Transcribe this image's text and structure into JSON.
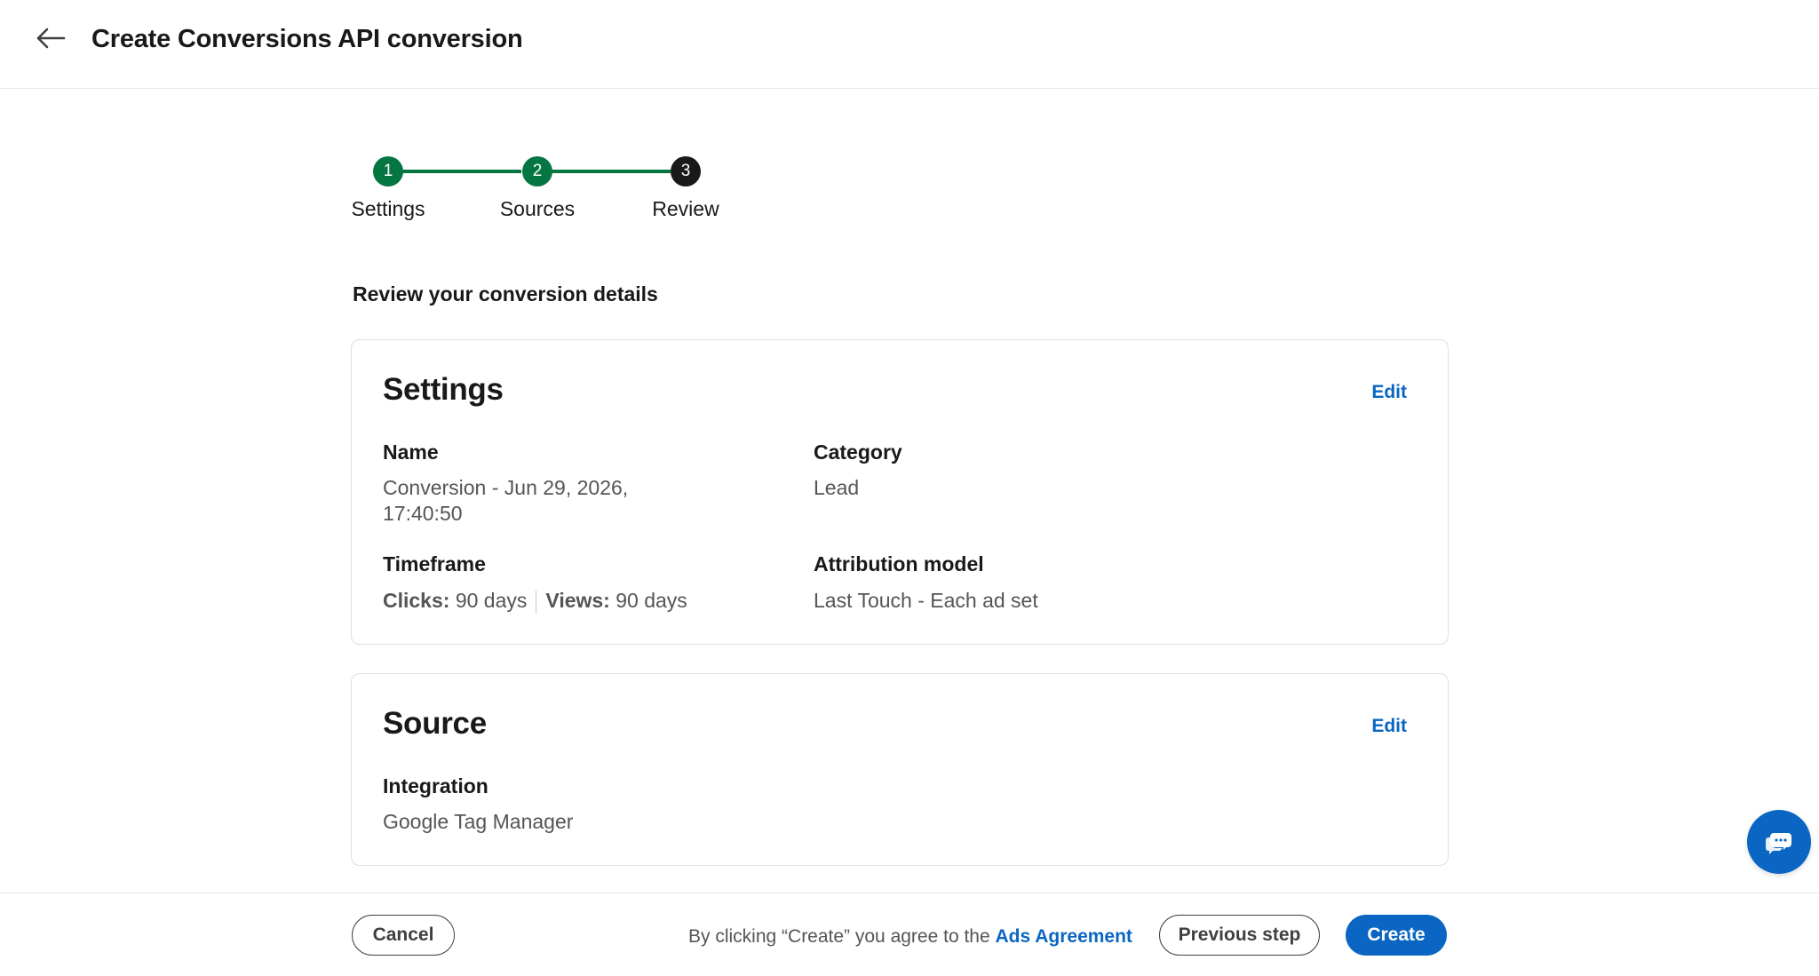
{
  "header": {
    "title": "Create Conversions API conversion"
  },
  "stepper": {
    "steps": [
      {
        "number": "1",
        "label": "Settings",
        "state": "done"
      },
      {
        "number": "2",
        "label": "Sources",
        "state": "done"
      },
      {
        "number": "3",
        "label": "Review",
        "state": "current"
      }
    ]
  },
  "main": {
    "heading": "Review your conversion details",
    "settings_card": {
      "title": "Settings",
      "edit_label": "Edit",
      "name_label": "Name",
      "name_value_line1": "Conversion - Jun 29, 2026,",
      "name_value_line2": "17:40:50",
      "category_label": "Category",
      "category_value": "Lead",
      "timeframe_label": "Timeframe",
      "clicks_label": "Clicks:",
      "clicks_value": "90 days",
      "views_label": "Views:",
      "views_value": "90 days",
      "attribution_label": "Attribution model",
      "attribution_value": "Last Touch - Each ad set"
    },
    "source_card": {
      "title": "Source",
      "edit_label": "Edit",
      "integration_label": "Integration",
      "integration_value": "Google Tag Manager"
    }
  },
  "footer": {
    "cancel_label": "Cancel",
    "agreement_text": "By clicking “Create” you agree to the ",
    "agreement_link": "Ads Agreement",
    "previous_label": "Previous step",
    "create_label": "Create"
  },
  "colors": {
    "accent": "#0a66c2",
    "step_done": "#057642",
    "step_current": "#191919"
  }
}
